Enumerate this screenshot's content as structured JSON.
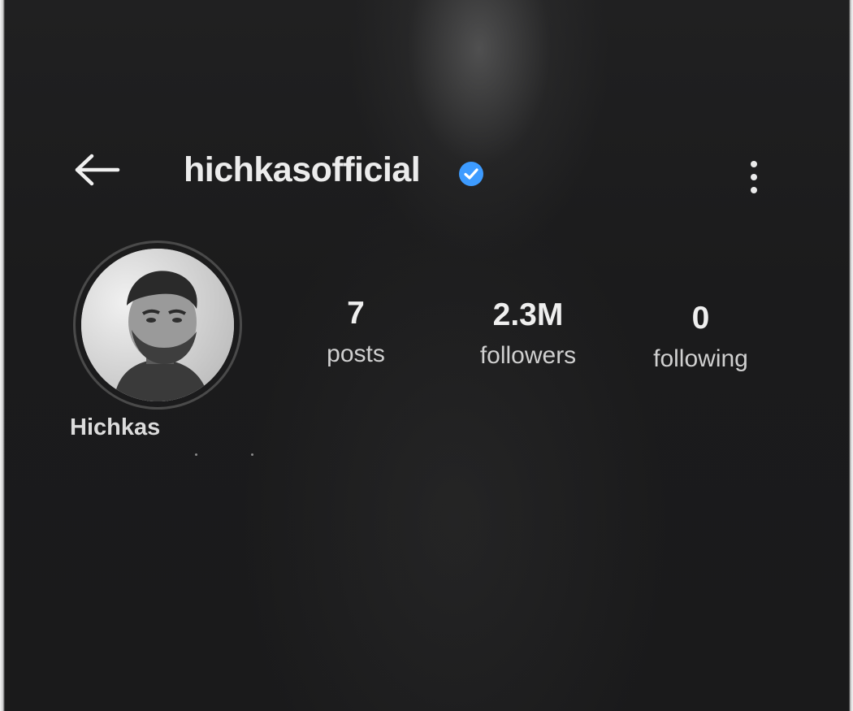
{
  "header": {
    "username": "hichkasofficial",
    "back_icon": "arrow-left-icon",
    "verified_icon": "verified-badge-icon",
    "more_icon": "more-vertical-icon",
    "verified_color": "#3d9bff"
  },
  "profile": {
    "display_name": "Hichkas",
    "avatar_icon": "profile-photo"
  },
  "stats": [
    {
      "value": "7",
      "label": "posts"
    },
    {
      "value": "2.3M",
      "label": "followers"
    },
    {
      "value": "0",
      "label": "following"
    }
  ]
}
